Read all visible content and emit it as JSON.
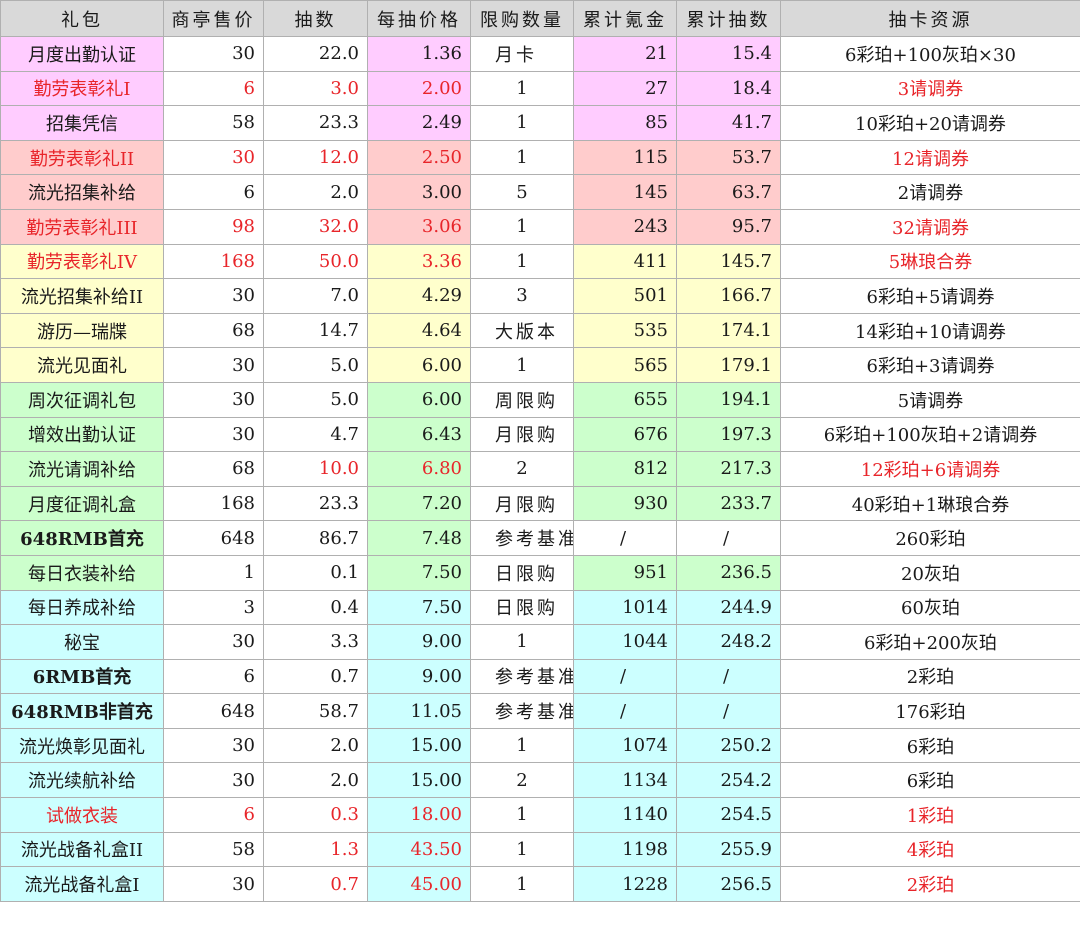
{
  "headers": [
    "礼包",
    "商亭售价",
    "抽数",
    "每抽价格",
    "限购数量",
    "累计氪金",
    "累计抽数",
    "抽卡资源"
  ],
  "colors": {
    "pink": "#ffccff",
    "red": "#ffcccc",
    "yellow": "#ffffcc",
    "green": "#ccffcc",
    "cyan": "#ccffff",
    "header": "#d9d9d9",
    "red_text": "#e8252a"
  },
  "rows": [
    {
      "name": "月度出勤认证",
      "price": "30",
      "pulls": "22.0",
      "per_pull": "1.36",
      "limit": "月卡",
      "total_cost": "21",
      "total_pulls": "15.4",
      "resource": "6彩珀+100灰珀×30",
      "name_bg": "pink",
      "per_bg": "pink",
      "cum_bg": "pink",
      "red": []
    },
    {
      "name": "勤劳表彰礼I",
      "price": "6",
      "pulls": "3.0",
      "per_pull": "2.00",
      "limit": "1",
      "total_cost": "27",
      "total_pulls": "18.4",
      "resource": "3请调券",
      "name_bg": "pink",
      "per_bg": "pink",
      "cum_bg": "pink",
      "red": [
        "name",
        "price",
        "pulls",
        "per_pull",
        "resource"
      ]
    },
    {
      "name": "招集凭信",
      "price": "58",
      "pulls": "23.3",
      "per_pull": "2.49",
      "limit": "1",
      "total_cost": "85",
      "total_pulls": "41.7",
      "resource": "10彩珀+20请调券",
      "name_bg": "pink",
      "per_bg": "pink",
      "cum_bg": "pink",
      "red": []
    },
    {
      "name": "勤劳表彰礼II",
      "price": "30",
      "pulls": "12.0",
      "per_pull": "2.50",
      "limit": "1",
      "total_cost": "115",
      "total_pulls": "53.7",
      "resource": "12请调券",
      "name_bg": "red",
      "per_bg": "red",
      "cum_bg": "red",
      "red": [
        "name",
        "price",
        "pulls",
        "per_pull",
        "resource"
      ]
    },
    {
      "name": "流光招集补给",
      "price": "6",
      "pulls": "2.0",
      "per_pull": "3.00",
      "limit": "5",
      "total_cost": "145",
      "total_pulls": "63.7",
      "resource": "2请调券",
      "name_bg": "red",
      "per_bg": "red",
      "cum_bg": "red",
      "red": []
    },
    {
      "name": "勤劳表彰礼III",
      "price": "98",
      "pulls": "32.0",
      "per_pull": "3.06",
      "limit": "1",
      "total_cost": "243",
      "total_pulls": "95.7",
      "resource": "32请调券",
      "name_bg": "red",
      "per_bg": "red",
      "cum_bg": "red",
      "red": [
        "name",
        "price",
        "pulls",
        "per_pull",
        "resource"
      ]
    },
    {
      "name": "勤劳表彰礼IV",
      "price": "168",
      "pulls": "50.0",
      "per_pull": "3.36",
      "limit": "1",
      "total_cost": "411",
      "total_pulls": "145.7",
      "resource": "5琳琅合券",
      "name_bg": "yellow",
      "per_bg": "yellow",
      "cum_bg": "yellow",
      "red": [
        "name",
        "price",
        "pulls",
        "per_pull",
        "resource"
      ]
    },
    {
      "name": "流光招集补给II",
      "price": "30",
      "pulls": "7.0",
      "per_pull": "4.29",
      "limit": "3",
      "total_cost": "501",
      "total_pulls": "166.7",
      "resource": "6彩珀+5请调券",
      "name_bg": "yellow",
      "per_bg": "yellow",
      "cum_bg": "yellow",
      "red": []
    },
    {
      "name": "游历—瑞牒",
      "price": "68",
      "pulls": "14.7",
      "per_pull": "4.64",
      "limit": "大版本",
      "total_cost": "535",
      "total_pulls": "174.1",
      "resource": "14彩珀+10请调券",
      "name_bg": "yellow",
      "per_bg": "yellow",
      "cum_bg": "yellow",
      "red": []
    },
    {
      "name": "流光见面礼",
      "price": "30",
      "pulls": "5.0",
      "per_pull": "6.00",
      "limit": "1",
      "total_cost": "565",
      "total_pulls": "179.1",
      "resource": "6彩珀+3请调券",
      "name_bg": "yellow",
      "per_bg": "yellow",
      "cum_bg": "yellow",
      "red": []
    },
    {
      "name": "周次征调礼包",
      "price": "30",
      "pulls": "5.0",
      "per_pull": "6.00",
      "limit": "周限购",
      "total_cost": "655",
      "total_pulls": "194.1",
      "resource": "5请调券",
      "name_bg": "green",
      "per_bg": "green",
      "cum_bg": "green",
      "red": []
    },
    {
      "name": "增效出勤认证",
      "price": "30",
      "pulls": "4.7",
      "per_pull": "6.43",
      "limit": "月限购",
      "total_cost": "676",
      "total_pulls": "197.3",
      "resource": "6彩珀+100灰珀+2请调券",
      "name_bg": "green",
      "per_bg": "green",
      "cum_bg": "green",
      "red": []
    },
    {
      "name": "流光请调补给",
      "price": "68",
      "pulls": "10.0",
      "per_pull": "6.80",
      "limit": "2",
      "total_cost": "812",
      "total_pulls": "217.3",
      "resource": "12彩珀+6请调券",
      "name_bg": "green",
      "per_bg": "green",
      "cum_bg": "green",
      "red": [
        "pulls",
        "per_pull",
        "resource"
      ]
    },
    {
      "name": "月度征调礼盒",
      "price": "168",
      "pulls": "23.3",
      "per_pull": "7.20",
      "limit": "月限购",
      "total_cost": "930",
      "total_pulls": "233.7",
      "resource": "40彩珀+1琳琅合券",
      "name_bg": "green",
      "per_bg": "green",
      "cum_bg": "green",
      "red": []
    },
    {
      "name": "648RMB首充",
      "price": "648",
      "pulls": "86.7",
      "per_pull": "7.48",
      "limit": "参考基准",
      "total_cost": "/",
      "total_pulls": "/",
      "resource": "260彩珀",
      "name_bg": "green",
      "per_bg": "green",
      "cum_bg": "none",
      "bold": true,
      "red": []
    },
    {
      "name": "每日衣装补给",
      "price": "1",
      "pulls": "0.1",
      "per_pull": "7.50",
      "limit": "日限购",
      "total_cost": "951",
      "total_pulls": "236.5",
      "resource": "20灰珀",
      "name_bg": "green",
      "per_bg": "green",
      "cum_bg": "green",
      "red": []
    },
    {
      "name": "每日养成补给",
      "price": "3",
      "pulls": "0.4",
      "per_pull": "7.50",
      "limit": "日限购",
      "total_cost": "1014",
      "total_pulls": "244.9",
      "resource": "60灰珀",
      "name_bg": "cyan",
      "per_bg": "cyan",
      "cum_bg": "cyan",
      "red": []
    },
    {
      "name": "秘宝",
      "price": "30",
      "pulls": "3.3",
      "per_pull": "9.00",
      "limit": "1",
      "total_cost": "1044",
      "total_pulls": "248.2",
      "resource": "6彩珀+200灰珀",
      "name_bg": "cyan",
      "per_bg": "cyan",
      "cum_bg": "cyan",
      "red": []
    },
    {
      "name": "6RMB首充",
      "price": "6",
      "pulls": "0.7",
      "per_pull": "9.00",
      "limit": "参考基准",
      "total_cost": "/",
      "total_pulls": "/",
      "resource": "2彩珀",
      "name_bg": "cyan",
      "per_bg": "cyan",
      "cum_bg": "cyan",
      "bold": true,
      "red": []
    },
    {
      "name": "648RMB非首充",
      "price": "648",
      "pulls": "58.7",
      "per_pull": "11.05",
      "limit": "参考基准",
      "total_cost": "/",
      "total_pulls": "/",
      "resource": "176彩珀",
      "name_bg": "cyan",
      "per_bg": "cyan",
      "cum_bg": "cyan",
      "bold": true,
      "red": []
    },
    {
      "name": "流光焕彰见面礼",
      "price": "30",
      "pulls": "2.0",
      "per_pull": "15.00",
      "limit": "1",
      "total_cost": "1074",
      "total_pulls": "250.2",
      "resource": "6彩珀",
      "name_bg": "cyan",
      "per_bg": "cyan",
      "cum_bg": "cyan",
      "red": []
    },
    {
      "name": "流光续航补给",
      "price": "30",
      "pulls": "2.0",
      "per_pull": "15.00",
      "limit": "2",
      "total_cost": "1134",
      "total_pulls": "254.2",
      "resource": "6彩珀",
      "name_bg": "cyan",
      "per_bg": "cyan",
      "cum_bg": "cyan",
      "red": []
    },
    {
      "name": "试做衣装",
      "price": "6",
      "pulls": "0.3",
      "per_pull": "18.00",
      "limit": "1",
      "total_cost": "1140",
      "total_pulls": "254.5",
      "resource": "1彩珀",
      "name_bg": "cyan",
      "per_bg": "cyan",
      "cum_bg": "cyan",
      "red": [
        "name",
        "price",
        "pulls",
        "per_pull",
        "resource"
      ]
    },
    {
      "name": "流光战备礼盒II",
      "price": "58",
      "pulls": "1.3",
      "per_pull": "43.50",
      "limit": "1",
      "total_cost": "1198",
      "total_pulls": "255.9",
      "resource": "4彩珀",
      "name_bg": "cyan",
      "per_bg": "cyan",
      "cum_bg": "cyan",
      "red": [
        "pulls",
        "per_pull",
        "resource"
      ]
    },
    {
      "name": "流光战备礼盒I",
      "price": "30",
      "pulls": "0.7",
      "per_pull": "45.00",
      "limit": "1",
      "total_cost": "1228",
      "total_pulls": "256.5",
      "resource": "2彩珀",
      "name_bg": "cyan",
      "per_bg": "cyan",
      "cum_bg": "cyan",
      "red": [
        "pulls",
        "per_pull",
        "resource"
      ]
    }
  ]
}
